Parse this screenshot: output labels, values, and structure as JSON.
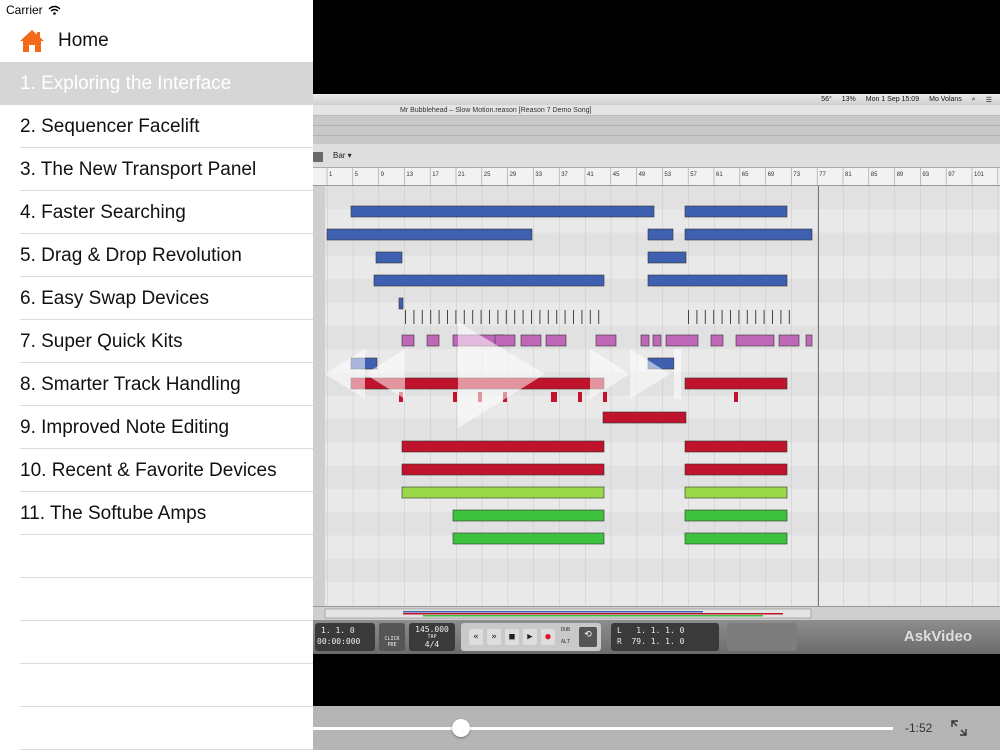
{
  "status_bar": {
    "carrier": "Carrier"
  },
  "sidebar": {
    "home_label": "Home",
    "lessons": [
      "1. Exploring the Interface",
      "2. Sequencer Facelift",
      "3. The New Transport Panel",
      "4. Faster Searching",
      "5. Drag & Drop Revolution",
      "6. Easy Swap Devices",
      "7. Super Quick Kits",
      "8. Smarter Track Handling",
      "9. Improved Note Editing",
      "10. Recent & Favorite Devices",
      "11. The Softube Amps"
    ],
    "active_index": 0
  },
  "video": {
    "menubar": {
      "clock": "Mon 1 Sep 15:09",
      "user": "Mo Volans",
      "battery": "13%",
      "temp": "56°"
    },
    "doc_title": "Mr Bubblehead – Slow Motion.reason [Reason 7 Demo Song]",
    "ruler_selector": "Bar",
    "ruler_ticks": [
      "1",
      "5",
      "9",
      "13",
      "17",
      "21",
      "25",
      "29",
      "33",
      "37",
      "41",
      "45",
      "49",
      "53",
      "57",
      "61",
      "65",
      "69",
      "73",
      "77",
      "81",
      "85",
      "89",
      "93",
      "97",
      "101",
      "105"
    ],
    "transport": {
      "position": "1. 1. 0",
      "time": "00:00:000",
      "tempo": "145.000",
      "signature": "4/4",
      "tap": "TAP",
      "click": "CLICK",
      "pre": "PRE",
      "dub": "DUB",
      "alt": "ALT",
      "loop_left_label": "L",
      "loop_right_label": "R",
      "loop_left": "1. 1. 1. 0",
      "loop_right": "79. 1. 1. 0"
    },
    "watermark": "AskVideo"
  },
  "player": {
    "time_remaining": "-1:52",
    "progress": 0.255
  },
  "colors": {
    "accent_home": "#f26b1d",
    "active_row": "#d6d6d6",
    "clip_blue": "#3f5fb0",
    "clip_red": "#c0142c",
    "clip_pink": "#c068b8",
    "clip_lime": "#9ad84a",
    "clip_green": "#3cc23c"
  }
}
